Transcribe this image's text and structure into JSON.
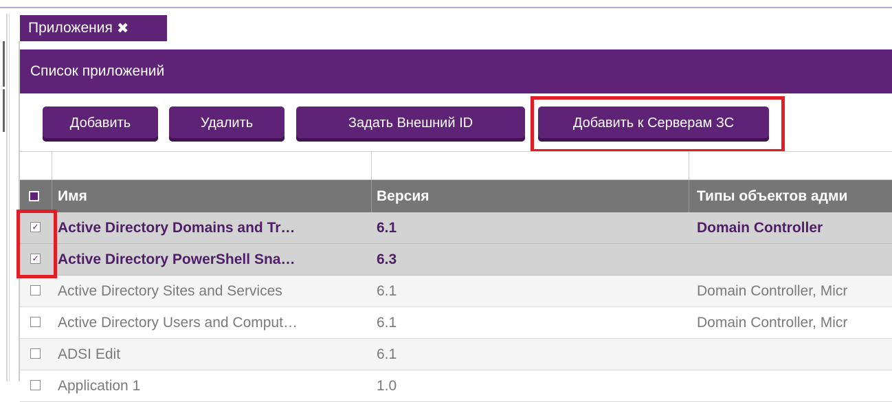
{
  "tab": {
    "label": "Приложения",
    "close_glyph": "✖"
  },
  "panel": {
    "title": "Список приложений"
  },
  "toolbar": {
    "add_label": "Добавить",
    "delete_label": "Удалить",
    "set_external_id_label": "Задать Внешний ID",
    "add_to_servers_label": "Добавить к Серверам ЗС"
  },
  "table": {
    "columns": [
      "Имя",
      "Версия",
      "Типы объектов адми"
    ],
    "rows": [
      {
        "checked": true,
        "name": "Active Directory Domains and Tr…",
        "version": "6.1",
        "types": "Domain Controller"
      },
      {
        "checked": true,
        "name": "Active Directory PowerShell Sna…",
        "version": "6.3",
        "types": ""
      },
      {
        "checked": false,
        "name": "Active Directory Sites and Services",
        "version": "6.1",
        "types": "Domain Controller, Micr"
      },
      {
        "checked": false,
        "name": "Active Directory Users and Comput…",
        "version": "6.1",
        "types": "Domain Controller, Micr"
      },
      {
        "checked": false,
        "name": "ADSI Edit",
        "version": "6.1",
        "types": ""
      },
      {
        "checked": false,
        "name": "Application 1",
        "version": "1.0",
        "types": ""
      }
    ]
  },
  "colors": {
    "accent": "#5e2277",
    "highlight": "#e01e26",
    "header_gray": "#767676"
  }
}
